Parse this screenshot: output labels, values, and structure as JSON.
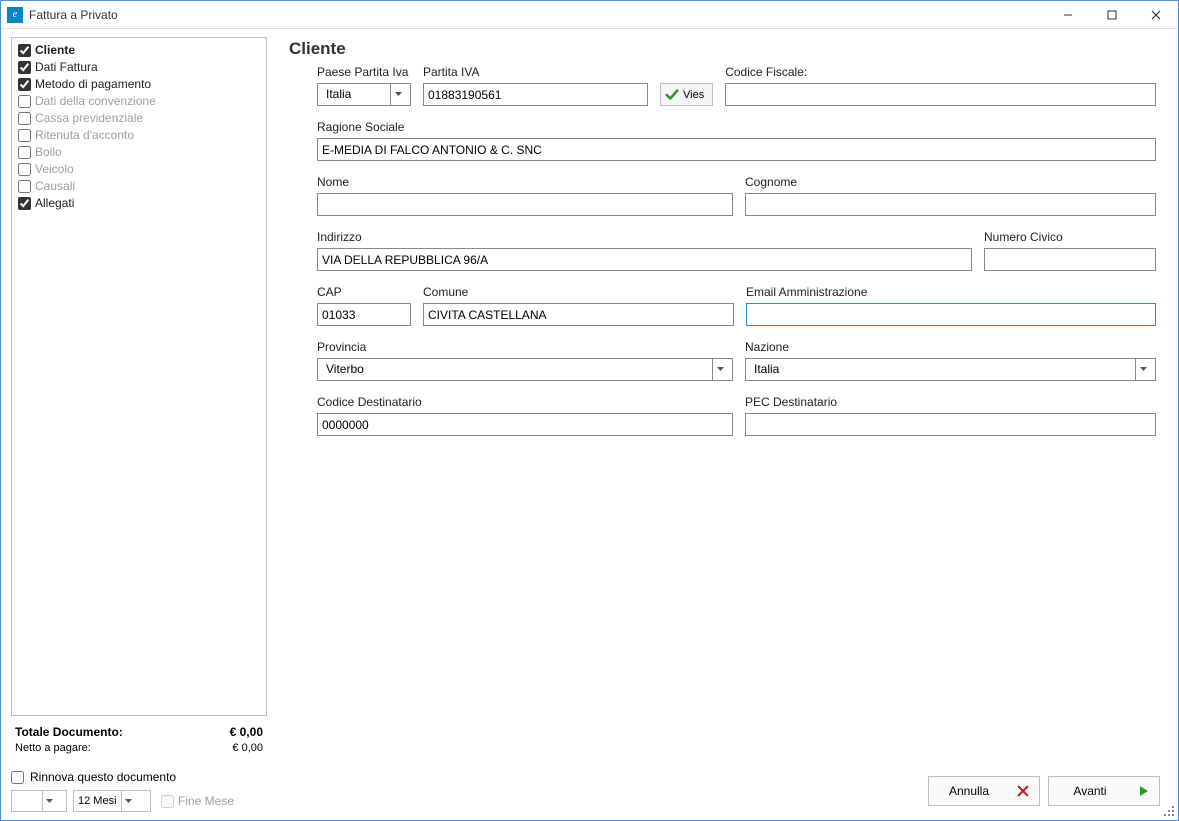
{
  "window": {
    "title": "Fattura a Privato"
  },
  "sidebar": {
    "items": [
      {
        "label": "Cliente",
        "checked": true,
        "bold": true,
        "enabled": true
      },
      {
        "label": "Dati Fattura",
        "checked": true,
        "bold": false,
        "enabled": true
      },
      {
        "label": "Metodo di pagamento",
        "checked": true,
        "bold": false,
        "enabled": true
      },
      {
        "label": "Dati della convenzione",
        "checked": false,
        "bold": false,
        "enabled": false
      },
      {
        "label": "Cassa previdenziale",
        "checked": false,
        "bold": false,
        "enabled": false
      },
      {
        "label": "Ritenuta d'acconto",
        "checked": false,
        "bold": false,
        "enabled": false
      },
      {
        "label": "Bollo",
        "checked": false,
        "bold": false,
        "enabled": false
      },
      {
        "label": "Veicolo",
        "checked": false,
        "bold": false,
        "enabled": false
      },
      {
        "label": "Causali",
        "checked": false,
        "bold": false,
        "enabled": false
      },
      {
        "label": "Allegati",
        "checked": true,
        "bold": false,
        "enabled": true
      }
    ]
  },
  "totals": {
    "label_totale": "Totale Documento:",
    "value_totale": "€ 0,00",
    "label_netto": "Netto a pagare:",
    "value_netto": "€ 0,00"
  },
  "renew": {
    "label": "Rinnova questo documento",
    "interval_value": "",
    "period_value": "12 Mesi",
    "fine_mese_label": "Fine Mese"
  },
  "form": {
    "heading": "Cliente",
    "paese_partita_iva": {
      "label": "Paese Partita Iva",
      "value": "Italia"
    },
    "partita_iva": {
      "label": "Partita IVA",
      "value": "01883190561"
    },
    "vies_label": "Vies",
    "codice_fiscale": {
      "label": "Codice Fiscale:",
      "value": ""
    },
    "ragione_sociale": {
      "label": "Ragione Sociale",
      "value": "E-MEDIA DI FALCO ANTONIO & C. SNC"
    },
    "nome": {
      "label": "Nome",
      "value": ""
    },
    "cognome": {
      "label": "Cognome",
      "value": ""
    },
    "indirizzo": {
      "label": "Indirizzo",
      "value": "VIA DELLA REPUBBLICA 96/A"
    },
    "numero_civico": {
      "label": "Numero Civico",
      "value": ""
    },
    "cap": {
      "label": "CAP",
      "value": "01033"
    },
    "comune": {
      "label": "Comune",
      "value": "CIVITA CASTELLANA"
    },
    "email_amministrazione": {
      "label": "Email Amministrazione",
      "value": ""
    },
    "provincia": {
      "label": "Provincia",
      "value": "Viterbo"
    },
    "nazione": {
      "label": "Nazione",
      "value": "Italia"
    },
    "codice_destinatario": {
      "label": "Codice Destinatario",
      "value": "0000000"
    },
    "pec_destinatario": {
      "label": "PEC Destinatario",
      "value": ""
    }
  },
  "footer": {
    "annulla": "Annulla",
    "avanti": "Avanti"
  }
}
